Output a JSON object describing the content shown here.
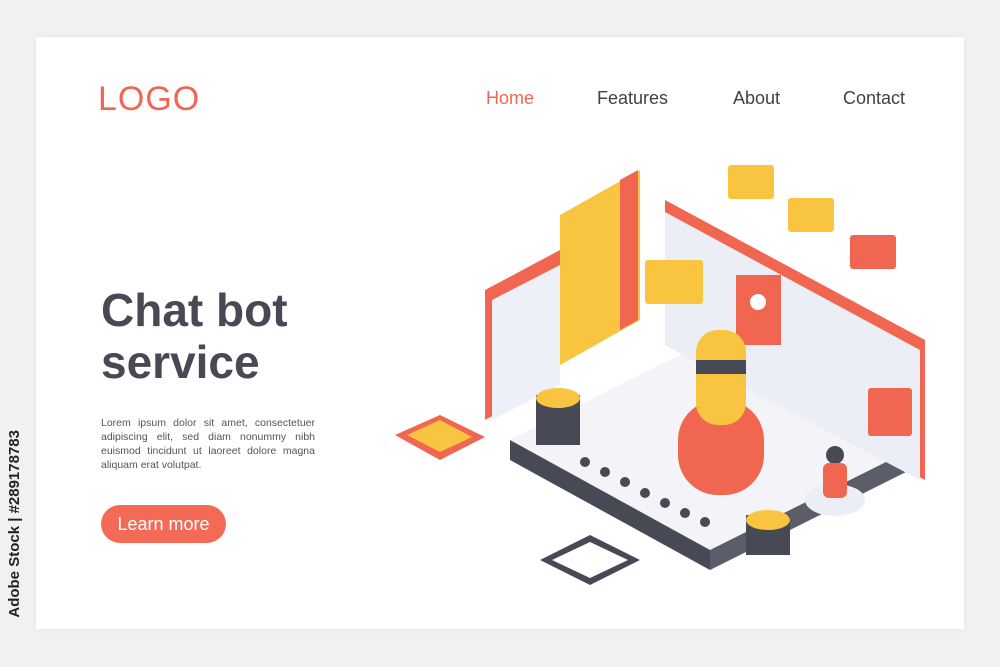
{
  "header": {
    "logo": "LOGO",
    "nav": [
      {
        "label": "Home",
        "active": true
      },
      {
        "label": "Features"
      },
      {
        "label": "About"
      },
      {
        "label": "Contact"
      }
    ]
  },
  "hero": {
    "title_line1": "Chat bot",
    "title_line2": "service",
    "body": "Lorem ipsum dolor sit amet, consectetuer adipiscing elit, sed diam nonummy nibh euismod tincidunt ut laoreet dolore magna aliquam erat volutpat.",
    "cta": "Learn more"
  },
  "watermark": "Adobe Stock | #289178783",
  "colors": {
    "accent": "#f36b57",
    "text": "#474955",
    "yellow": "#f9c440",
    "dark": "#3d3f4a"
  }
}
